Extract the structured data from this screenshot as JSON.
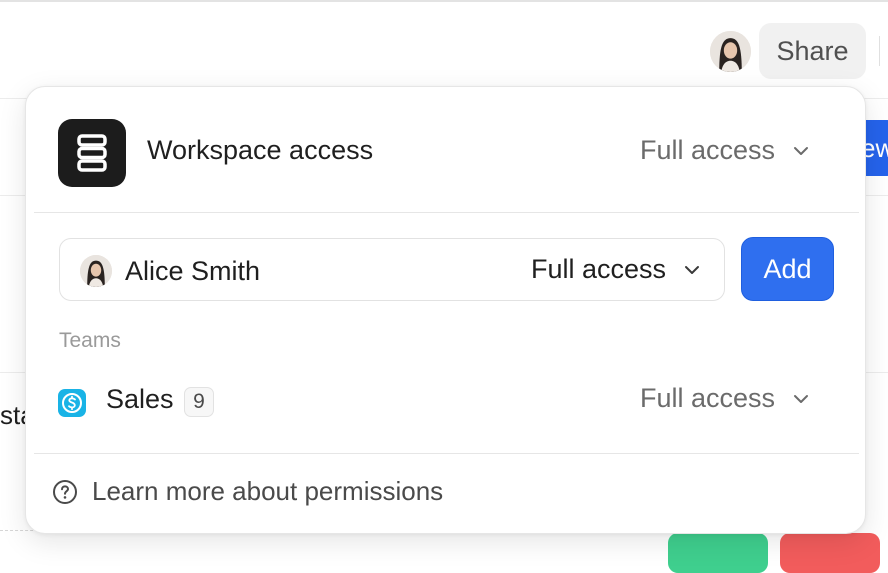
{
  "background": {
    "partial_button_text": "ew",
    "partial_text": "sta"
  },
  "header": {
    "share_label": "Share"
  },
  "popup": {
    "workspace": {
      "title": "Workspace access",
      "access": "Full access"
    },
    "invite": {
      "name": "Alice Smith",
      "access": "Full access",
      "add_label": "Add"
    },
    "teams": {
      "label": "Teams",
      "items": [
        {
          "name": "Sales",
          "count": "9",
          "access": "Full access",
          "icon": "dollar-icon"
        }
      ]
    },
    "footer": {
      "learn_more": "Learn more about permissions",
      "icon": "help-circle-icon"
    }
  },
  "colors": {
    "primary": "#2f6fef",
    "team_icon": "#19b3e6",
    "logo_bg": "#1c1c1c"
  }
}
